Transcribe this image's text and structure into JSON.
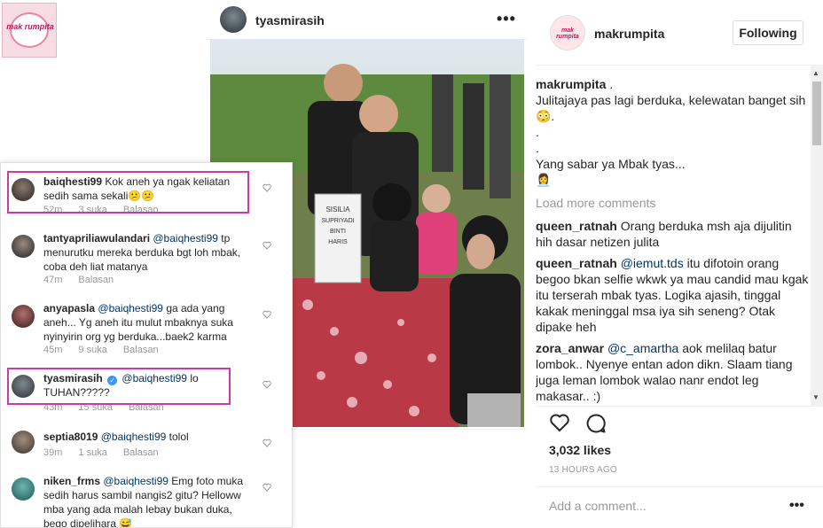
{
  "logo": {
    "text": "mak rumpita"
  },
  "post": {
    "username": "tyasmirasih",
    "more_icon": "more-icon",
    "photo_overlay_text": "SISILIA SUPRIYADI BINTI HARIS RURHANUDDIN LHR: JAKARTA 21-05-1963 WFT: JAKARTA 08-11-2017"
  },
  "comments_panel": {
    "items": [
      {
        "user": "baiqhesti99",
        "text": "Kok aneh ya ngak keliatan sedih sama sekali😕😕",
        "meta_time": "52m",
        "meta_likes": "3 suka",
        "meta_reply": "Balasan"
      },
      {
        "user": "tantyapriliawulandari",
        "mention": "@baiqhesti99",
        "text": "tp menurutku mereka berduka bgt loh mbak, coba deh liat matanya",
        "meta_time": "47m",
        "meta_reply": "Balasan"
      },
      {
        "user": "anyapasla",
        "mention": "@baiqhesti99",
        "text": "ga ada yang aneh... Yg aneh itu mulut mbaknya suka nyinyirin org yg berduka...baek2 karma",
        "meta_time": "45m",
        "meta_likes": "9 suka",
        "meta_reply": "Balasan"
      },
      {
        "user": "tyasmirasih",
        "mention": "@baiqhesti99",
        "text": "lo TUHAN?????",
        "meta_time": "43m",
        "meta_likes": "15 suka",
        "meta_reply": "Balasan"
      },
      {
        "user": "septia8019",
        "mention": "@baiqhesti99",
        "text": "tolol",
        "meta_time": "39m",
        "meta_likes": "1 suka",
        "meta_reply": "Balasan"
      },
      {
        "user": "niken_frms",
        "mention": "@baiqhesti99",
        "text": "Emg foto muka sedih harus sambil nangis2 gitu? Helloww mba yang ada malah lebay bukan duka, bego dipelihara 😅"
      }
    ]
  },
  "sidebar": {
    "username": "makrumpita",
    "follow_label": "Following",
    "caption_user": "makrumpita",
    "caption_lines": [
      ".",
      "Julitajaya pas lagi berduka, kelewatan banget sih😳.",
      ".",
      ".",
      "Yang sabar ya Mbak tyas...",
      "👩‍💼"
    ],
    "load_more": "Load more comments",
    "comments": [
      {
        "user": "queen_ratnah",
        "text": "Orang berduka msh aja dijulitin hih dasar netizen julita"
      },
      {
        "user": "queen_ratnah",
        "mention": "@iemut.tds",
        "text": "itu difotoin orang begoo bkan selfie wkwk ya mau candid mau kgak itu terserah mbak tyas. Logika ajasih, tinggal kakak meninggal msa iya sih seneng? Otak dipake heh"
      },
      {
        "user": "zora_anwar",
        "mention": "@c_amartha",
        "text": "aok melilaq batur lombok.. Nyenye entan adon dikn. Slaam tiang juga leman lombok walao nanr endot leg makasar.. :)"
      }
    ],
    "likes": "3,032 likes",
    "time_ago": "13 HOURS AGO",
    "add_comment_placeholder": "Add a comment...",
    "more_icon": "more-icon",
    "colors": {
      "highlight": "#cc3aa8",
      "mention": "#003569",
      "meta": "#999999"
    }
  }
}
